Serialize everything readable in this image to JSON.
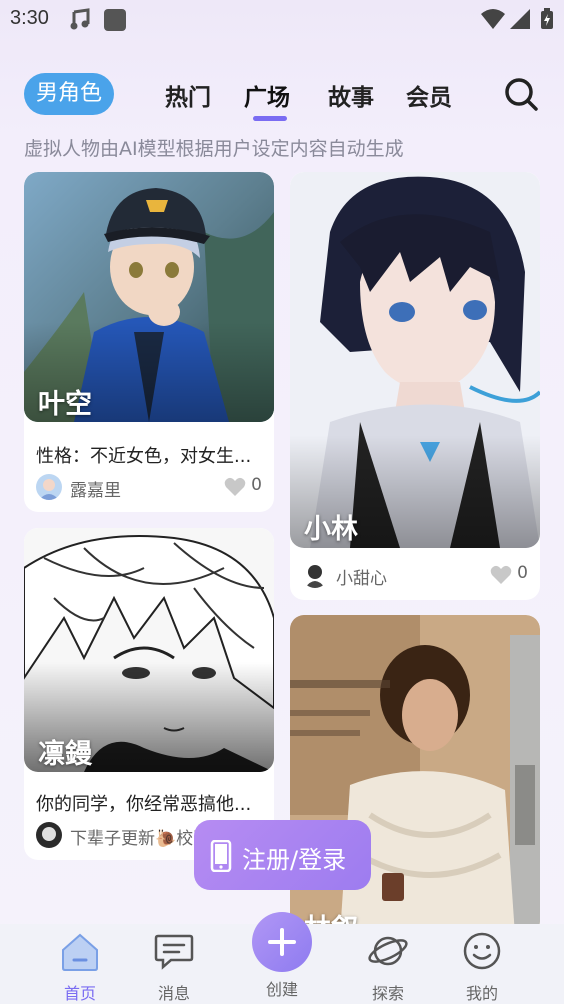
{
  "status_bar": {
    "time": "3:30",
    "icons": [
      "music-note-icon",
      "app-square-icon",
      "wifi-icon",
      "signal-icon",
      "battery-icon"
    ]
  },
  "top_nav": {
    "filter_pill": "男角色",
    "tabs": [
      {
        "label": "热门",
        "active": false
      },
      {
        "label": "广场",
        "active": true
      },
      {
        "label": "故事",
        "active": false
      },
      {
        "label": "会员",
        "active": false
      }
    ],
    "search_icon": "search-icon",
    "accent_color": "#7a6cf2",
    "pill_color": "#4aa3ea"
  },
  "subtitle": "虚拟人物由AI模型根据用户设定内容自动生成",
  "cards": [
    {
      "name": "叶空",
      "description": "性格：不近女色，对女生...",
      "author": "露嘉里",
      "likes": "0"
    },
    {
      "name": "小林",
      "description": "",
      "author": "小甜心",
      "likes": "0"
    },
    {
      "name": "凛鏝",
      "description": "你的同学，你经常恶搞他...",
      "author": "下辈子更新🐌校园",
      "likes": ""
    },
    {
      "name": "林叙",
      "description": "",
      "author": "",
      "likes": ""
    }
  ],
  "login_button": {
    "label": "注册/登录",
    "icon": "phone-icon"
  },
  "bottom_nav": {
    "items": [
      {
        "label": "首页",
        "icon": "home-icon",
        "active": true
      },
      {
        "label": "消息",
        "icon": "message-icon",
        "active": false
      },
      {
        "label": "创建",
        "icon": "plus-icon",
        "active": false
      },
      {
        "label": "探索",
        "icon": "planet-icon",
        "active": false
      },
      {
        "label": "我的",
        "icon": "smiley-icon",
        "active": false
      }
    ]
  }
}
